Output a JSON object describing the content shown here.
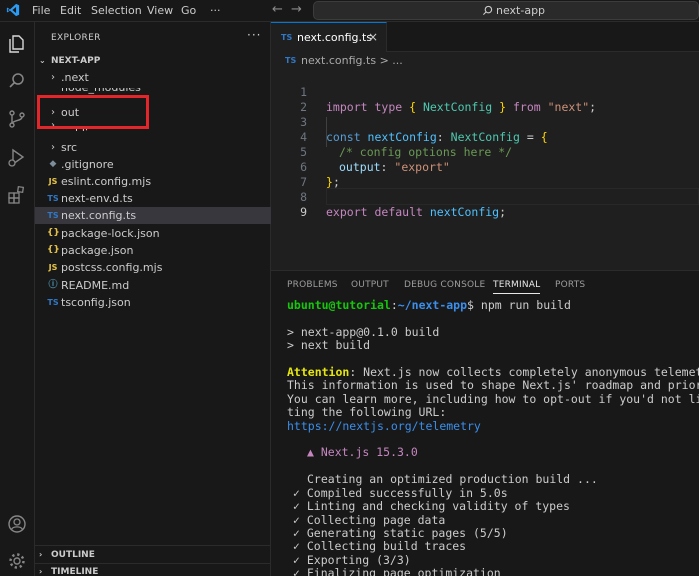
{
  "titlebar": {
    "menu": [
      "File",
      "Edit",
      "Selection",
      "View",
      "Go",
      "···"
    ],
    "search": "next-app"
  },
  "explorer": {
    "title": "EXPLORER",
    "more": "···",
    "root": "NEXT-APP",
    "hidden_item": "node_modules",
    "items": [
      {
        "label": ".next",
        "kind": "folder"
      },
      {
        "label": "out",
        "kind": "folder"
      },
      {
        "label": "public",
        "kind": "folder"
      },
      {
        "label": "src",
        "kind": "folder"
      },
      {
        "label": ".gitignore",
        "kind": "git",
        "icon": "◆"
      },
      {
        "label": "eslint.config.mjs",
        "kind": "js",
        "icon": "JS"
      },
      {
        "label": "next-env.d.ts",
        "kind": "ts",
        "icon": "TS"
      },
      {
        "label": "next.config.ts",
        "kind": "ts",
        "icon": "TS"
      },
      {
        "label": "package-lock.json",
        "kind": "json",
        "icon": "{}"
      },
      {
        "label": "package.json",
        "kind": "json",
        "icon": "{}"
      },
      {
        "label": "postcss.config.mjs",
        "kind": "js",
        "icon": "JS"
      },
      {
        "label": "README.md",
        "kind": "info",
        "icon": "ⓘ"
      },
      {
        "label": "tsconfig.json",
        "kind": "ts",
        "icon": "TS"
      }
    ],
    "outline": "OUTLINE",
    "timeline": "TIMELINE"
  },
  "editor": {
    "tab": {
      "icon": "TS",
      "name": "next.config.ts",
      "close": "×"
    },
    "breadcrumb": {
      "icon": "TS",
      "path": "next.config.ts > ..."
    },
    "line_numbers": [
      "1",
      "2",
      "3",
      "4",
      "5",
      "6",
      "7",
      "8",
      "9"
    ],
    "code": {
      "l1": [
        "import",
        " type ",
        "{",
        " NextConfig ",
        "}",
        " from ",
        "\"next\"",
        ";"
      ],
      "l3": [
        "const",
        " nextConfig",
        ": ",
        "NextConfig",
        " = ",
        "{"
      ],
      "l4": "/* config options here */",
      "l5": [
        "output",
        ": ",
        "\"export\""
      ],
      "l6": [
        "}",
        ";"
      ],
      "l8": [
        "export",
        " default ",
        "nextConfig",
        ";"
      ]
    }
  },
  "panel": {
    "tabs": [
      "PROBLEMS",
      "OUTPUT",
      "DEBUG CONSOLE",
      "TERMINAL",
      "PORTS"
    ],
    "active_tab": "TERMINAL",
    "terminal": {
      "prompt_user": "ubuntu@tutorial",
      "prompt_sep": ":",
      "prompt_path": "~/next-app",
      "prompt_cmd": "$ npm run build",
      "script1": "> next-app@0.1.0 build",
      "script2": "> next build",
      "attention_label": "Attention",
      "attention_text": ": Next.js now collects completely anonymous telemetry regarding usage.",
      "info1": "This information is used to shape Next.js' roadmap and prioritize features.",
      "info2": "You can learn more, including how to opt-out if you'd not like to participate in this anonymous program, by visi",
      "info3": "ting the following URL:",
      "url": "https://nextjs.org/telemetry",
      "brand": "▲ Next.js 15.3.0",
      "creating": "Creating an optimized production build ...",
      "steps": [
        "✓ Compiled successfully in 5.0s",
        "✓ Linting and checking validity of types",
        "✓ Collecting page data",
        "✓ Generating static pages (5/5)",
        "✓ Collecting build traces",
        "✓ Exporting (3/3)",
        "✓ Finalizing page optimization"
      ]
    }
  }
}
